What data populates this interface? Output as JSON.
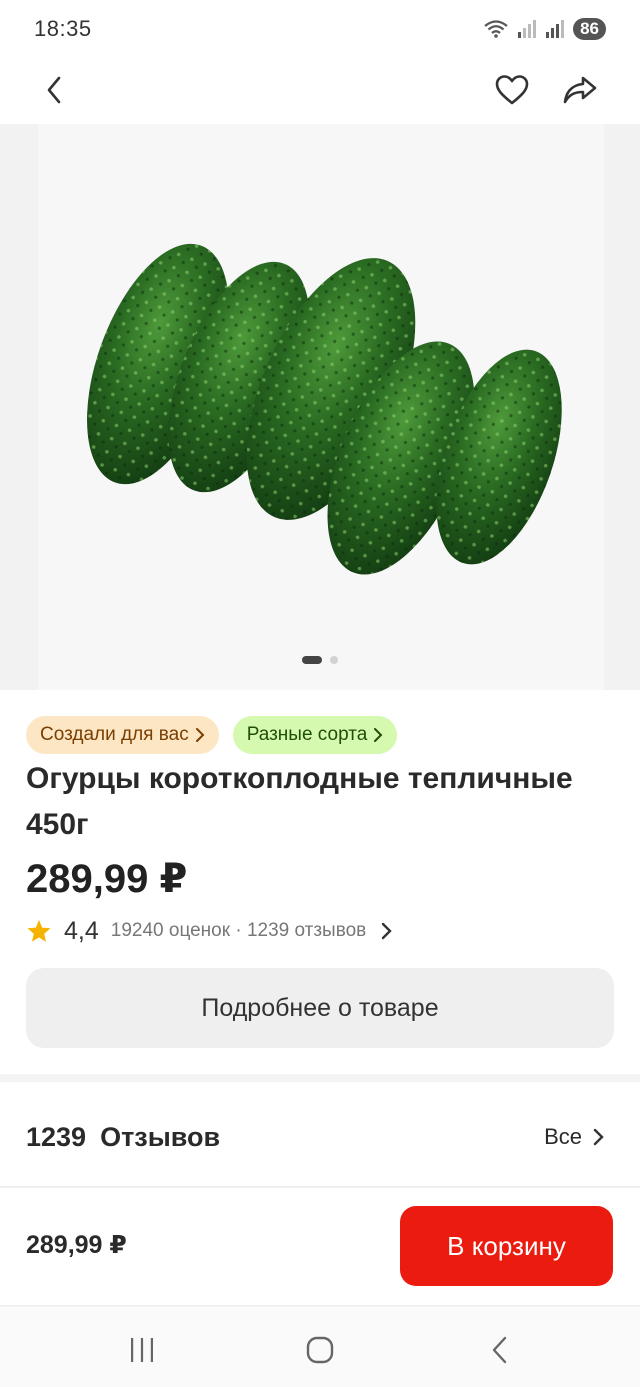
{
  "status_bar": {
    "time": "18:35",
    "battery": "86"
  },
  "icons": {
    "back": "chevron-left-icon",
    "favorite": "heart-icon",
    "share": "share-icon",
    "star": "star-icon",
    "chevron": "chevron-right-icon"
  },
  "gallery": {
    "pages": 2,
    "active_page": 1
  },
  "chips": [
    {
      "label": "Создали для вас"
    },
    {
      "label": "Разные сорта"
    }
  ],
  "product": {
    "title": "Огурцы короткоплодные тепличные 450г",
    "price": "289,99 ₽",
    "rating": "4,4",
    "rating_meta": "19240 оценок · 1239 отзывов"
  },
  "details_button": "Подробнее о товаре",
  "reviews": {
    "count": "1239",
    "label": "Отзывов",
    "all_label": "Все"
  },
  "bottom_bar": {
    "price": "289,99 ₽",
    "cart_label": "В корзину"
  },
  "colors": {
    "accent": "#ec1b0f",
    "star": "#f5b301",
    "chip_orange_bg": "#fde6c3",
    "chip_green_bg": "#d6f9b0",
    "cucumber": "#1f5a1c"
  }
}
